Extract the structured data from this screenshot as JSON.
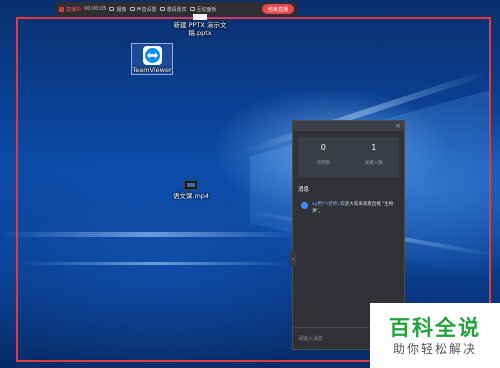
{
  "recording_bar": {
    "status": "直播中",
    "timer": "00:00:05",
    "camera_label": "摄像",
    "mic_label": "声音设置",
    "invite_label": "邀请嘉宾",
    "whiteboard_label": "互动面板",
    "stop_label": "结束直播",
    "frame_color": "#e23b3b"
  },
  "desktop": {
    "icons": [
      {
        "label": "新建 PPTX 演示文稿.pptx",
        "icon": "pptx-file-icon"
      },
      {
        "label": "TeamViewer",
        "icon": "teamviewer-icon"
      },
      {
        "label": "语文课.mp4",
        "icon": "video-file-icon"
      }
    ]
  },
  "panel": {
    "stats": [
      {
        "value": "0",
        "label": "点赞数"
      },
      {
        "value": "1",
        "label": "观看人数"
      }
    ],
    "messages_title": "消息",
    "messages": [
      {
        "sender": "xy用户(老师)",
        "text": "欢迎大家来观看直播 \"生物课\"。"
      }
    ],
    "input_placeholder": "请输入消息",
    "close_icon": "×",
    "collapse_icon": "‹"
  },
  "watermark": {
    "title": "百科全说",
    "subtitle": "助你轻松解决",
    "color": "#20a33a"
  }
}
